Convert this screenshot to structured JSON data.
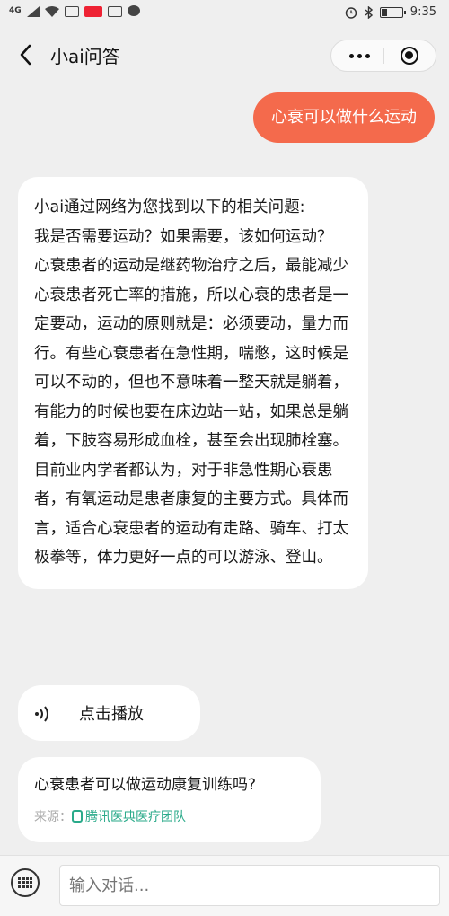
{
  "status": {
    "network": "4G",
    "time": "9:35"
  },
  "nav": {
    "title": "小ai问答",
    "more": "more",
    "close": "close"
  },
  "chat": {
    "user_message": "心衰可以做什么运动",
    "answer": {
      "intro": "小ai通过网络为您找到以下的相关问题:",
      "question": "我是否需要运动？如果需要，该如何运动？",
      "body": "心衰患者的运动是继药物治疗之后，最能减少心衰患者死亡率的措施，所以心衰的患者是一定要动，运动的原则就是：必须要动，量力而行。有些心衰患者在急性期，喘憋，这时候是可以不动的，但也不意味着一整天就是躺着，有能力的时候也要在床边站一站，如果总是躺着，下肢容易形成血栓，甚至会出现肺栓塞。目前业内学者都认为，对于非急性期心衰患者，有氧运动是患者康复的主要方式。具体而言，适合心衰患者的运动有走路、骑车、打太极拳等，体力更好一点的可以游泳、登山。"
    },
    "audio_label": "点击播放",
    "related": {
      "question": "心衰患者可以做运动康复训练吗?",
      "source_label": "来源：",
      "source_name": "腾讯医典医疗团队"
    }
  },
  "input": {
    "placeholder": "输入对话..."
  },
  "colors": {
    "accent": "#f46a4c",
    "source_green": "#2aaa8a"
  }
}
